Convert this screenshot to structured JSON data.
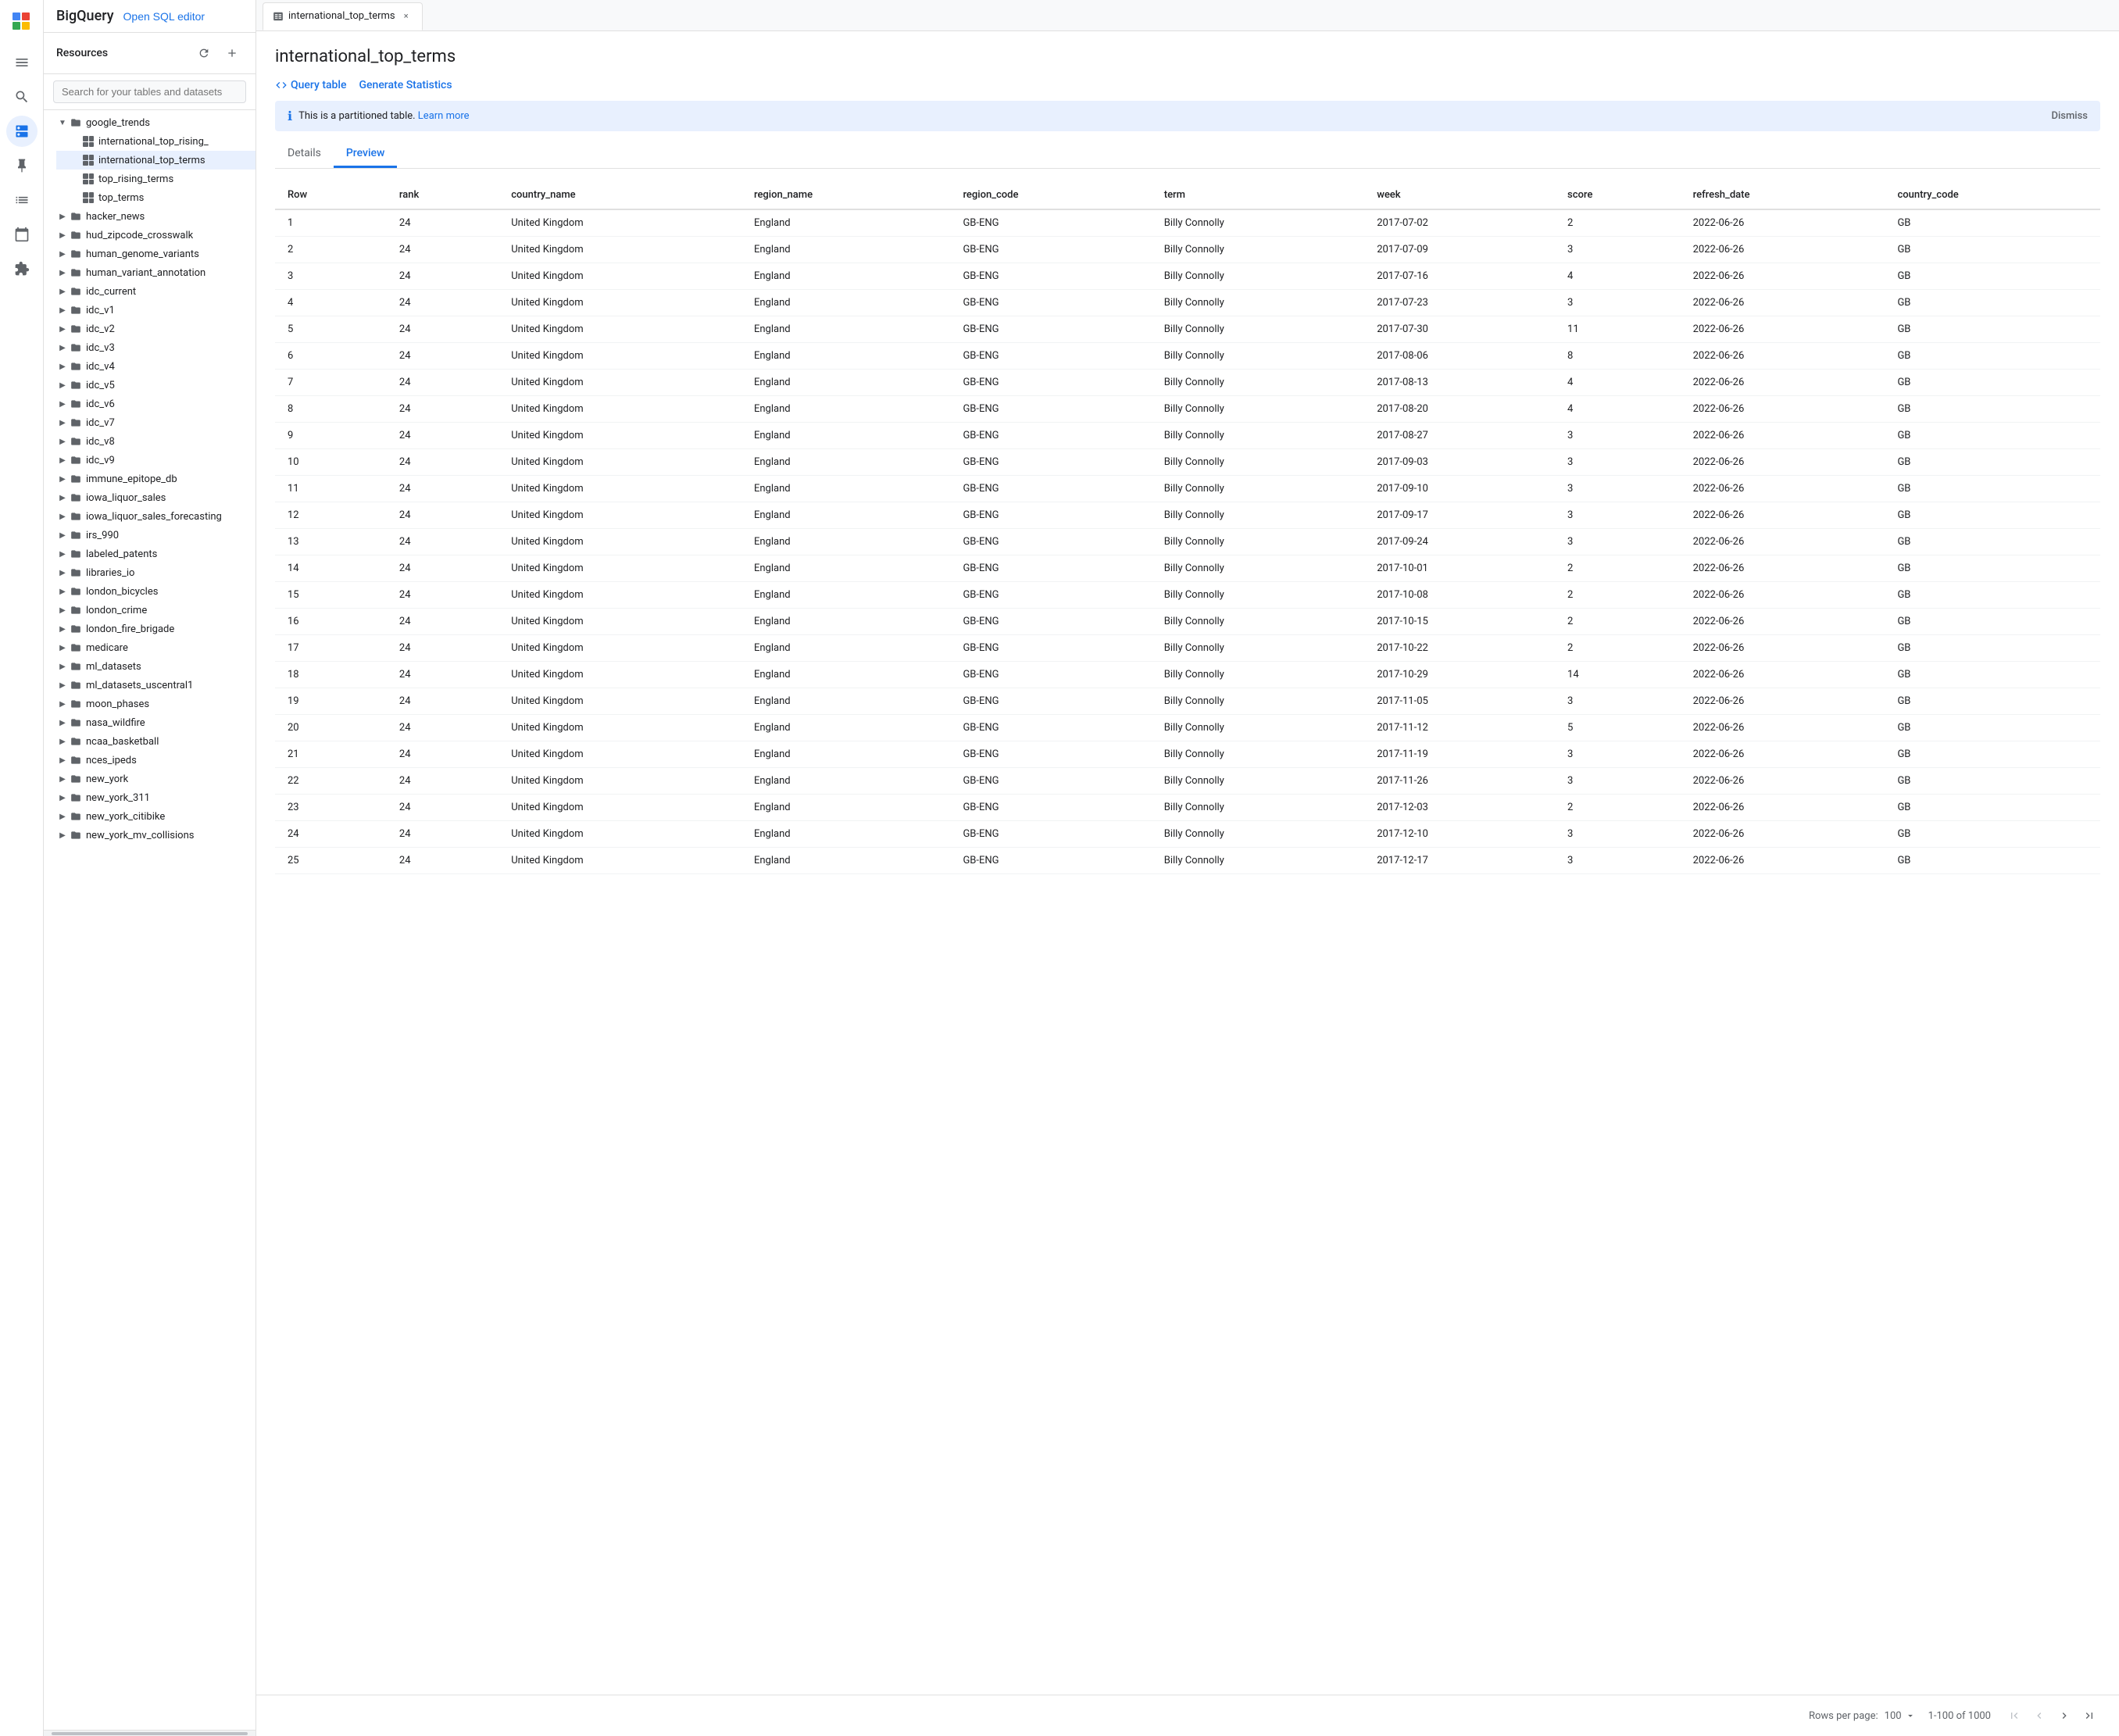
{
  "app": {
    "title": "BigQuery",
    "open_sql_label": "Open SQL editor"
  },
  "sidebar": {
    "title": "Resources",
    "search_placeholder": "Search for your tables and datasets",
    "tree": [
      {
        "id": "google_trends",
        "label": "google_trends",
        "type": "dataset",
        "expanded": true,
        "children": [
          {
            "id": "international_top_rising_",
            "label": "international_top_rising_",
            "type": "table"
          },
          {
            "id": "international_top_terms",
            "label": "international_top_terms",
            "type": "table",
            "selected": true
          },
          {
            "id": "top_rising_terms",
            "label": "top_rising_terms",
            "type": "table"
          },
          {
            "id": "top_terms",
            "label": "top_terms",
            "type": "table"
          }
        ]
      },
      {
        "id": "hacker_news",
        "label": "hacker_news",
        "type": "dataset",
        "expanded": false
      },
      {
        "id": "hud_zipcode_crosswalk",
        "label": "hud_zipcode_crosswalk",
        "type": "dataset",
        "expanded": false
      },
      {
        "id": "human_genome_variants",
        "label": "human_genome_variants",
        "type": "dataset",
        "expanded": false
      },
      {
        "id": "human_variant_annotation",
        "label": "human_variant_annotation",
        "type": "dataset",
        "expanded": false
      },
      {
        "id": "idc_current",
        "label": "idc_current",
        "type": "dataset",
        "expanded": false
      },
      {
        "id": "idc_v1",
        "label": "idc_v1",
        "type": "dataset",
        "expanded": false
      },
      {
        "id": "idc_v2",
        "label": "idc_v2",
        "type": "dataset",
        "expanded": false
      },
      {
        "id": "idc_v3",
        "label": "idc_v3",
        "type": "dataset",
        "expanded": false
      },
      {
        "id": "idc_v4",
        "label": "idc_v4",
        "type": "dataset",
        "expanded": false
      },
      {
        "id": "idc_v5",
        "label": "idc_v5",
        "type": "dataset",
        "expanded": false
      },
      {
        "id": "idc_v6",
        "label": "idc_v6",
        "type": "dataset",
        "expanded": false
      },
      {
        "id": "idc_v7",
        "label": "idc_v7",
        "type": "dataset",
        "expanded": false
      },
      {
        "id": "idc_v8",
        "label": "idc_v8",
        "type": "dataset",
        "expanded": false
      },
      {
        "id": "idc_v9",
        "label": "idc_v9",
        "type": "dataset",
        "expanded": false
      },
      {
        "id": "immune_epitope_db",
        "label": "immune_epitope_db",
        "type": "dataset",
        "expanded": false
      },
      {
        "id": "iowa_liquor_sales",
        "label": "iowa_liquor_sales",
        "type": "dataset",
        "expanded": false
      },
      {
        "id": "iowa_liquor_sales_forecasting",
        "label": "iowa_liquor_sales_forecasting",
        "type": "dataset",
        "expanded": false
      },
      {
        "id": "irs_990",
        "label": "irs_990",
        "type": "dataset",
        "expanded": false
      },
      {
        "id": "labeled_patents",
        "label": "labeled_patents",
        "type": "dataset",
        "expanded": false
      },
      {
        "id": "libraries_io",
        "label": "libraries_io",
        "type": "dataset",
        "expanded": false
      },
      {
        "id": "london_bicycles",
        "label": "london_bicycles",
        "type": "dataset",
        "expanded": false
      },
      {
        "id": "london_crime",
        "label": "london_crime",
        "type": "dataset",
        "expanded": false
      },
      {
        "id": "london_fire_brigade",
        "label": "london_fire_brigade",
        "type": "dataset",
        "expanded": false
      },
      {
        "id": "medicare",
        "label": "medicare",
        "type": "dataset",
        "expanded": false
      },
      {
        "id": "ml_datasets",
        "label": "ml_datasets",
        "type": "dataset",
        "expanded": false
      },
      {
        "id": "ml_datasets_uscentral1",
        "label": "ml_datasets_uscentral1",
        "type": "dataset",
        "expanded": false
      },
      {
        "id": "moon_phases",
        "label": "moon_phases",
        "type": "dataset",
        "expanded": false
      },
      {
        "id": "nasa_wildfire",
        "label": "nasa_wildfire",
        "type": "dataset",
        "expanded": false
      },
      {
        "id": "ncaa_basketball",
        "label": "ncaa_basketball",
        "type": "dataset",
        "expanded": false
      },
      {
        "id": "nces_ipeds",
        "label": "nces_ipeds",
        "type": "dataset",
        "expanded": false
      },
      {
        "id": "new_york",
        "label": "new_york",
        "type": "dataset",
        "expanded": false
      },
      {
        "id": "new_york_311",
        "label": "new_york_311",
        "type": "dataset",
        "expanded": false
      },
      {
        "id": "new_york_citibike",
        "label": "new_york_citibike",
        "type": "dataset",
        "expanded": false
      },
      {
        "id": "new_york_mv_collisions",
        "label": "new_york_mv_collisions",
        "type": "dataset",
        "expanded": false
      }
    ]
  },
  "tab": {
    "label": "international_top_terms",
    "close_label": "×"
  },
  "page": {
    "title": "international_top_terms",
    "query_table_label": "Query table",
    "generate_stats_label": "Generate Statistics",
    "info_text": "This is a partitioned table.",
    "learn_more_label": "Learn more",
    "dismiss_label": "Dismiss",
    "tabs": [
      {
        "label": "Details",
        "active": false
      },
      {
        "label": "Preview",
        "active": true
      }
    ],
    "columns": [
      "Row",
      "rank",
      "country_name",
      "region_name",
      "region_code",
      "term",
      "week",
      "score",
      "refresh_date",
      "country_code"
    ],
    "rows": [
      [
        1,
        24,
        "United Kingdom",
        "England",
        "GB-ENG",
        "Billy Connolly",
        "2017-07-02",
        2,
        "2022-06-26",
        "GB"
      ],
      [
        2,
        24,
        "United Kingdom",
        "England",
        "GB-ENG",
        "Billy Connolly",
        "2017-07-09",
        3,
        "2022-06-26",
        "GB"
      ],
      [
        3,
        24,
        "United Kingdom",
        "England",
        "GB-ENG",
        "Billy Connolly",
        "2017-07-16",
        4,
        "2022-06-26",
        "GB"
      ],
      [
        4,
        24,
        "United Kingdom",
        "England",
        "GB-ENG",
        "Billy Connolly",
        "2017-07-23",
        3,
        "2022-06-26",
        "GB"
      ],
      [
        5,
        24,
        "United Kingdom",
        "England",
        "GB-ENG",
        "Billy Connolly",
        "2017-07-30",
        11,
        "2022-06-26",
        "GB"
      ],
      [
        6,
        24,
        "United Kingdom",
        "England",
        "GB-ENG",
        "Billy Connolly",
        "2017-08-06",
        8,
        "2022-06-26",
        "GB"
      ],
      [
        7,
        24,
        "United Kingdom",
        "England",
        "GB-ENG",
        "Billy Connolly",
        "2017-08-13",
        4,
        "2022-06-26",
        "GB"
      ],
      [
        8,
        24,
        "United Kingdom",
        "England",
        "GB-ENG",
        "Billy Connolly",
        "2017-08-20",
        4,
        "2022-06-26",
        "GB"
      ],
      [
        9,
        24,
        "United Kingdom",
        "England",
        "GB-ENG",
        "Billy Connolly",
        "2017-08-27",
        3,
        "2022-06-26",
        "GB"
      ],
      [
        10,
        24,
        "United Kingdom",
        "England",
        "GB-ENG",
        "Billy Connolly",
        "2017-09-03",
        3,
        "2022-06-26",
        "GB"
      ],
      [
        11,
        24,
        "United Kingdom",
        "England",
        "GB-ENG",
        "Billy Connolly",
        "2017-09-10",
        3,
        "2022-06-26",
        "GB"
      ],
      [
        12,
        24,
        "United Kingdom",
        "England",
        "GB-ENG",
        "Billy Connolly",
        "2017-09-17",
        3,
        "2022-06-26",
        "GB"
      ],
      [
        13,
        24,
        "United Kingdom",
        "England",
        "GB-ENG",
        "Billy Connolly",
        "2017-09-24",
        3,
        "2022-06-26",
        "GB"
      ],
      [
        14,
        24,
        "United Kingdom",
        "England",
        "GB-ENG",
        "Billy Connolly",
        "2017-10-01",
        2,
        "2022-06-26",
        "GB"
      ],
      [
        15,
        24,
        "United Kingdom",
        "England",
        "GB-ENG",
        "Billy Connolly",
        "2017-10-08",
        2,
        "2022-06-26",
        "GB"
      ],
      [
        16,
        24,
        "United Kingdom",
        "England",
        "GB-ENG",
        "Billy Connolly",
        "2017-10-15",
        2,
        "2022-06-26",
        "GB"
      ],
      [
        17,
        24,
        "United Kingdom",
        "England",
        "GB-ENG",
        "Billy Connolly",
        "2017-10-22",
        2,
        "2022-06-26",
        "GB"
      ],
      [
        18,
        24,
        "United Kingdom",
        "England",
        "GB-ENG",
        "Billy Connolly",
        "2017-10-29",
        14,
        "2022-06-26",
        "GB"
      ],
      [
        19,
        24,
        "United Kingdom",
        "England",
        "GB-ENG",
        "Billy Connolly",
        "2017-11-05",
        3,
        "2022-06-26",
        "GB"
      ],
      [
        20,
        24,
        "United Kingdom",
        "England",
        "GB-ENG",
        "Billy Connolly",
        "2017-11-12",
        5,
        "2022-06-26",
        "GB"
      ],
      [
        21,
        24,
        "United Kingdom",
        "England",
        "GB-ENG",
        "Billy Connolly",
        "2017-11-19",
        3,
        "2022-06-26",
        "GB"
      ],
      [
        22,
        24,
        "United Kingdom",
        "England",
        "GB-ENG",
        "Billy Connolly",
        "2017-11-26",
        3,
        "2022-06-26",
        "GB"
      ],
      [
        23,
        24,
        "United Kingdom",
        "England",
        "GB-ENG",
        "Billy Connolly",
        "2017-12-03",
        2,
        "2022-06-26",
        "GB"
      ],
      [
        24,
        24,
        "United Kingdom",
        "England",
        "GB-ENG",
        "Billy Connolly",
        "2017-12-10",
        3,
        "2022-06-26",
        "GB"
      ],
      [
        25,
        24,
        "United Kingdom",
        "England",
        "GB-ENG",
        "Billy Connolly",
        "2017-12-17",
        3,
        "2022-06-26",
        "GB"
      ]
    ]
  },
  "footer": {
    "rows_per_page_label": "Rows per page:",
    "rows_per_page_value": "100",
    "pagination_label": "1-100 of 1000"
  }
}
